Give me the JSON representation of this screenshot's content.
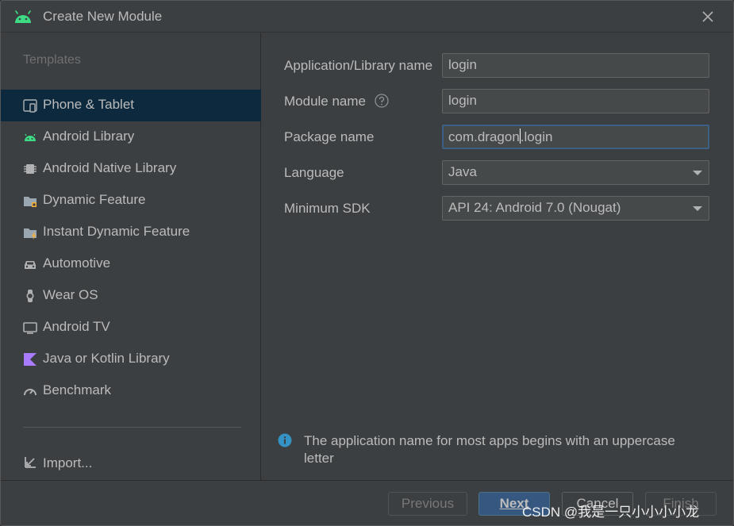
{
  "window": {
    "title": "Create New Module"
  },
  "sidebar": {
    "heading": "Templates",
    "items": [
      {
        "label": "Phone & Tablet",
        "icon": "phone-tablet-icon",
        "selected": true
      },
      {
        "label": "Android Library",
        "icon": "android-icon",
        "selected": false
      },
      {
        "label": "Android Native Library",
        "icon": "chip-icon",
        "selected": false
      },
      {
        "label": "Dynamic Feature",
        "icon": "folder-icon",
        "selected": false
      },
      {
        "label": "Instant Dynamic Feature",
        "icon": "folder-bolt-icon",
        "selected": false
      },
      {
        "label": "Automotive",
        "icon": "car-icon",
        "selected": false
      },
      {
        "label": "Wear OS",
        "icon": "watch-icon",
        "selected": false
      },
      {
        "label": "Android TV",
        "icon": "tv-icon",
        "selected": false
      },
      {
        "label": "Java or Kotlin Library",
        "icon": "kotlin-icon",
        "selected": false
      },
      {
        "label": "Benchmark",
        "icon": "gauge-icon",
        "selected": false
      }
    ],
    "import_label": "Import..."
  },
  "form": {
    "app_name": {
      "label": "Application/Library name",
      "value": "login"
    },
    "module_name": {
      "label": "Module name",
      "value": "login"
    },
    "package_name": {
      "label": "Package name",
      "value_before_cursor": "com.dragon",
      "value_after_cursor": ".login"
    },
    "language": {
      "label": "Language",
      "value": "Java"
    },
    "min_sdk": {
      "label": "Minimum SDK",
      "value": "API 24: Android 7.0 (Nougat)"
    }
  },
  "info": {
    "text": "The application name for most apps begins with an uppercase letter"
  },
  "footer": {
    "previous": "Previous",
    "next": "Next",
    "cancel": "Cancel",
    "finish": "Finish"
  },
  "watermark": "CSDN @我是一只小小小小龙",
  "colors": {
    "selected_bg": "#0d293e",
    "accent": "#3592c4",
    "android_green": "#3ddc84",
    "primary_button": "#365880"
  }
}
